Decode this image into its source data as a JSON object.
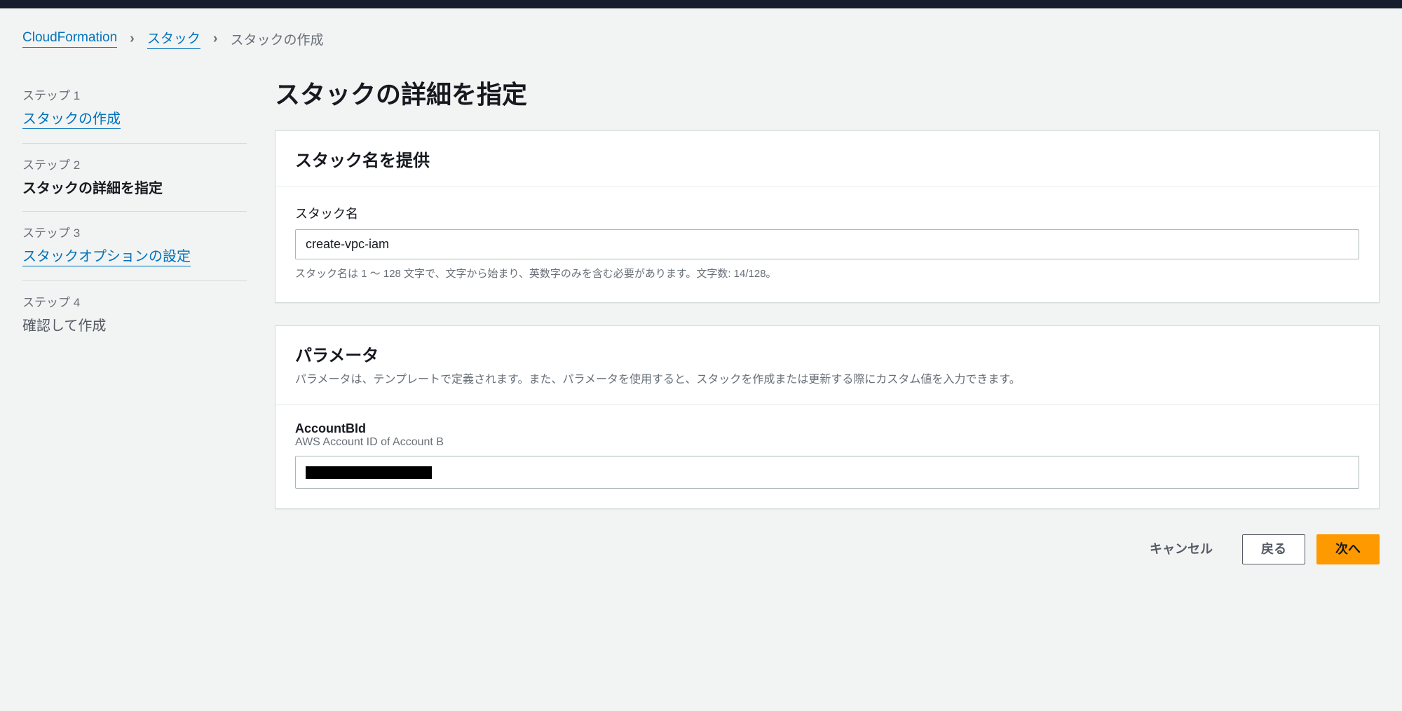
{
  "breadcrumb": {
    "root": "CloudFormation",
    "stack": "スタック",
    "current": "スタックの作成"
  },
  "sidebar": {
    "steps": [
      {
        "num": "ステップ 1",
        "title": "スタックの作成",
        "state": "link"
      },
      {
        "num": "ステップ 2",
        "title": "スタックの詳細を指定",
        "state": "active"
      },
      {
        "num": "ステップ 3",
        "title": "スタックオプションの設定",
        "state": "link"
      },
      {
        "num": "ステップ 4",
        "title": "確認して作成",
        "state": "pending"
      }
    ]
  },
  "page": {
    "title": "スタックの詳細を指定"
  },
  "stackNamePanel": {
    "heading": "スタック名を提供",
    "label": "スタック名",
    "value": "create-vpc-iam",
    "hint": "スタック名は 1 ～ 128 文字で、文字から始まり、英数字のみを含む必要があります。文字数: 14/128。"
  },
  "paramsPanel": {
    "heading": "パラメータ",
    "description": "パラメータは、テンプレートで定義されます。また、パラメータを使用すると、スタックを作成または更新する際にカスタム値を入力できます。",
    "params": [
      {
        "name": "AccountBId",
        "description": "AWS Account ID of Account B",
        "redacted": true
      }
    ]
  },
  "footer": {
    "cancel": "キャンセル",
    "back": "戻る",
    "next": "次へ"
  }
}
